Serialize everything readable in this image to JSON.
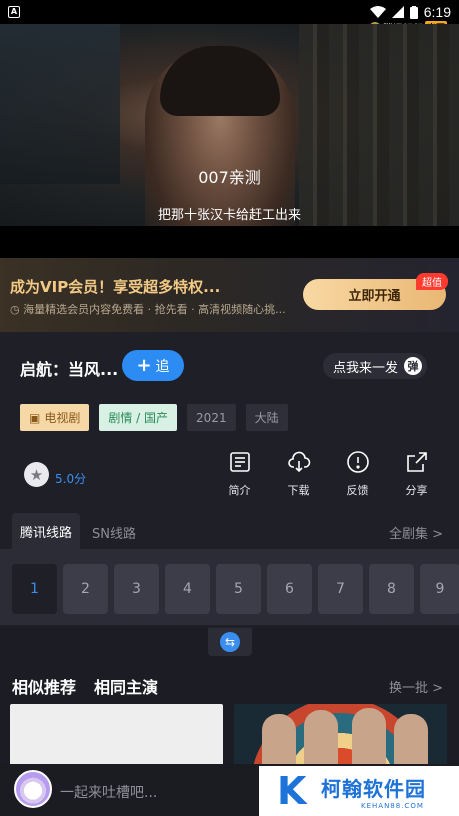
{
  "status_bar": {
    "app_icon": "A",
    "time": "6:19",
    "logo_text": "腾讯视频",
    "logo_tag": "出圈"
  },
  "video": {
    "subtitle_top": "007亲测",
    "subtitle_bottom": "把那十张汉卡给赶工出来"
  },
  "vip_banner": {
    "title": "成为VIP会员！享受超多特权...",
    "subtitle": "海量精选会员内容免费看 · 抢先看 · 高清视频随心挑...",
    "button_label": "立即开通",
    "badge": "超值"
  },
  "show": {
    "title": "启航：当风...",
    "follow_label": "追",
    "danmu_label": "点我来一发",
    "danmu_icon_text": "弹",
    "tags": [
      "电视剧",
      "剧情 / 国产",
      "2021",
      "大陆"
    ],
    "rating": "5.0分",
    "actions": [
      {
        "label": "简介",
        "icon": "document-icon"
      },
      {
        "label": "下载",
        "icon": "cloud-download-icon"
      },
      {
        "label": "反馈",
        "icon": "alert-icon"
      },
      {
        "label": "分享",
        "icon": "share-icon"
      }
    ]
  },
  "routes": {
    "active": "腾讯线路",
    "other": "SN线路",
    "all_episodes": "全剧集 >"
  },
  "episodes": [
    "1",
    "2",
    "3",
    "4",
    "5",
    "6",
    "7",
    "8",
    "9"
  ],
  "recommend": {
    "similar": "相似推荐",
    "same_cast": "相同主演",
    "refresh": "换一批 >"
  },
  "comment": {
    "placeholder": "一起来吐槽吧..."
  },
  "watermark": {
    "brand": "柯翰软件园",
    "domain": "KEHAN88.COM",
    "logo_letter": "K"
  },
  "colors": {
    "accent": "#3a8ef0",
    "vip_gold": "#f3c986",
    "background": "#1e1f27"
  }
}
